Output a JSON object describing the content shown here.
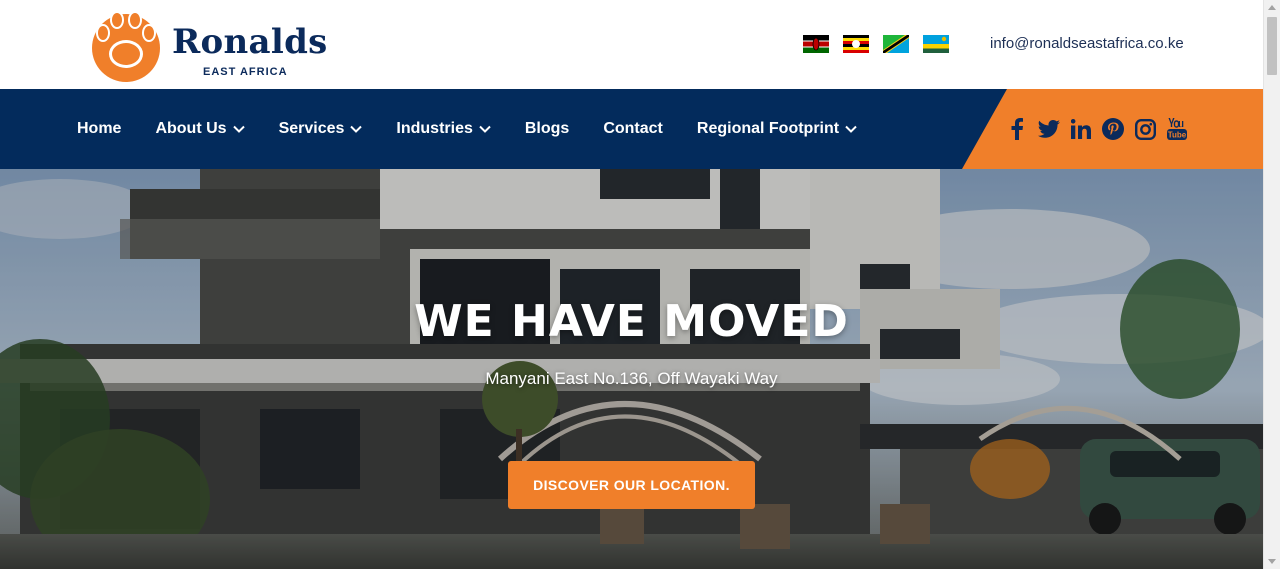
{
  "brand": {
    "name": "Ronalds",
    "subtitle": "EAST AFRICA",
    "primary_color": "#032b5c",
    "accent_color": "#f07f2a"
  },
  "header": {
    "flags": [
      "kenya-flag",
      "uganda-flag",
      "tanzania-flag",
      "rwanda-flag"
    ],
    "email": "info@ronaldseastafrica.co.ke"
  },
  "nav": {
    "items": [
      {
        "label": "Home",
        "dropdown": false
      },
      {
        "label": "About Us",
        "dropdown": true
      },
      {
        "label": "Services",
        "dropdown": true
      },
      {
        "label": "Industries",
        "dropdown": true
      },
      {
        "label": "Blogs",
        "dropdown": false
      },
      {
        "label": "Contact",
        "dropdown": false
      },
      {
        "label": "Regional Footprint",
        "dropdown": true
      }
    ],
    "social": [
      "facebook-icon",
      "twitter-icon",
      "linkedin-icon",
      "pinterest-icon",
      "instagram-icon",
      "youtube-icon"
    ]
  },
  "hero": {
    "title": "WE HAVE MOVED",
    "address": "Manyani East No.136, Off Wayaki Way",
    "cta_label": "DISCOVER OUR LOCATION."
  }
}
